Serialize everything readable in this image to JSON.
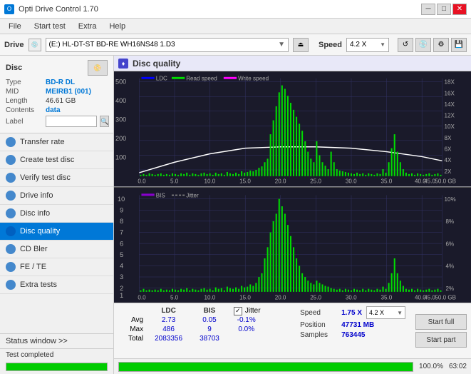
{
  "app": {
    "title": "Opti Drive Control 1.70",
    "icon": "O"
  },
  "titlebar": {
    "title": "Opti Drive Control 1.70",
    "minimize": "─",
    "maximize": "□",
    "close": "✕"
  },
  "menubar": {
    "items": [
      "File",
      "Start test",
      "Extra",
      "Help"
    ]
  },
  "drivebar": {
    "label": "Drive",
    "drive_name": "(E:)  HL-DT-ST BD-RE  WH16NS48 1.D3",
    "speed_label": "Speed",
    "speed_value": "4.2 X"
  },
  "disc": {
    "header": "Disc",
    "type_label": "Type",
    "type_value": "BD-R DL",
    "mid_label": "MID",
    "mid_value": "MEIRB1 (001)",
    "length_label": "Length",
    "length_value": "46.61 GB",
    "contents_label": "Contents",
    "contents_value": "data",
    "label_label": "Label",
    "label_value": ""
  },
  "nav": {
    "items": [
      {
        "id": "transfer-rate",
        "label": "Transfer rate",
        "active": false
      },
      {
        "id": "create-test-disc",
        "label": "Create test disc",
        "active": false
      },
      {
        "id": "verify-test-disc",
        "label": "Verify test disc",
        "active": false
      },
      {
        "id": "drive-info",
        "label": "Drive info",
        "active": false
      },
      {
        "id": "disc-info",
        "label": "Disc info",
        "active": false
      },
      {
        "id": "disc-quality",
        "label": "Disc quality",
        "active": true
      },
      {
        "id": "cd-bler",
        "label": "CD Bler",
        "active": false
      },
      {
        "id": "fe-te",
        "label": "FE / TE",
        "active": false
      },
      {
        "id": "extra-tests",
        "label": "Extra tests",
        "active": false
      }
    ]
  },
  "status": {
    "window_btn": "Status window >>",
    "text": "Test completed",
    "progress": 100,
    "time": "63:02"
  },
  "disc_quality": {
    "title": "Disc quality",
    "chart1": {
      "legend": [
        "LDC",
        "Read speed",
        "Write speed"
      ],
      "y_max": 500,
      "y_right_max": 18,
      "y_right_labels": [
        "18X",
        "16X",
        "14X",
        "12X",
        "10X",
        "8X",
        "6X",
        "4X",
        "2X"
      ],
      "x_max": 50,
      "x_labels": [
        "0.0",
        "5.0",
        "10.0",
        "15.0",
        "20.0",
        "25.0",
        "30.0",
        "35.0",
        "40.0",
        "45.0",
        "50.0 GB"
      ]
    },
    "chart2": {
      "legend": [
        "BIS",
        "Jitter"
      ],
      "y_max": 10,
      "y_right_max": 10,
      "y_right_labels": [
        "10%",
        "8%",
        "6%",
        "4%",
        "2%"
      ],
      "x_max": 50,
      "x_labels": [
        "0.0",
        "5.0",
        "10.0",
        "15.0",
        "20.0",
        "25.0",
        "30.0",
        "35.0",
        "40.0",
        "45.0",
        "50.0 GB"
      ]
    },
    "stats": {
      "headers": [
        "LDC",
        "BIS",
        "",
        "Jitter",
        "Speed",
        ""
      ],
      "avg_label": "Avg",
      "avg_ldc": "2.73",
      "avg_bis": "0.05",
      "avg_jitter": "-0.1%",
      "avg_speed": "1.75 X",
      "max_label": "Max",
      "max_ldc": "486",
      "max_bis": "9",
      "max_jitter": "0.0%",
      "total_label": "Total",
      "total_ldc": "2083356",
      "total_bis": "38703",
      "position_label": "Position",
      "position_value": "47731 MB",
      "samples_label": "Samples",
      "samples_value": "763445",
      "speed_dropdown": "4.2 X",
      "jitter_checked": true,
      "jitter_label": "Jitter"
    },
    "buttons": {
      "start_full": "Start full",
      "start_part": "Start part"
    }
  }
}
